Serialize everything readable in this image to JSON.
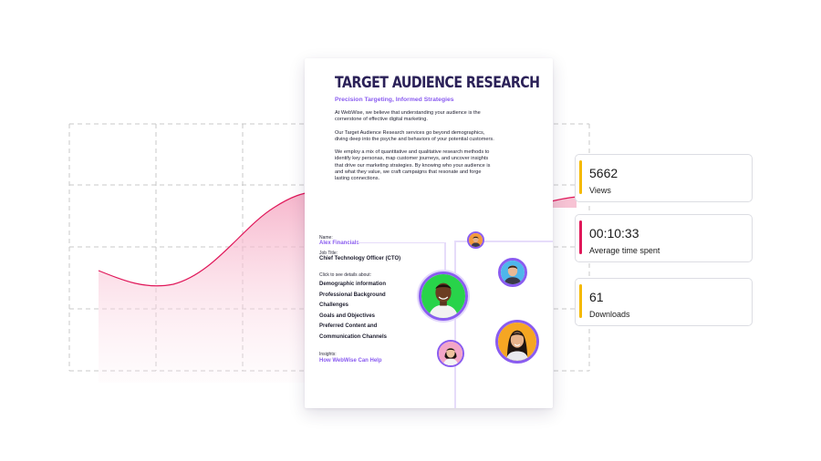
{
  "document": {
    "title": "TARGET AUDIENCE RESEARCH",
    "subtitle": "Precision Targeting, Informed Strategies",
    "paragraphs": [
      "At WebWise, we believe that understanding your audience is the cornerstone of effective digital marketing.",
      "Our Target Audience Research services go beyond demographics, diving deep into the psyche and behaviors of your potential customers.",
      "We employ a mix of quantitative and qualitative research methods to identify key personas, map customer journeys, and uncover insights that drive our marketing strategies. By knowing who your audience is and what they value, we craft campaigns that resonate and forge lasting connections."
    ],
    "name_label": "Name:",
    "name_value": "Alex Financials",
    "job_label": "Job Title:",
    "job_value": "Chief Technology Officer (CTO)",
    "details_label": "Click to see details about:",
    "details": [
      "Demographic information",
      "Professional Background",
      "Challenges",
      "Goals and Objectives",
      "Preferred Content and",
      "Communication Channels"
    ],
    "insights_label": "Insights:",
    "insights_value": "How WebWise Can Help"
  },
  "stats": [
    {
      "value": "5662",
      "label": "Views",
      "color": "#f5b900"
    },
    {
      "value": "00:10:33",
      "label": "Average time spent",
      "color": "#e0185a"
    },
    {
      "value": "61",
      "label": "Downloads",
      "color": "#f5b900"
    }
  ],
  "colors": {
    "accent_purple": "#8a5cf0",
    "title_navy": "#2b2158",
    "chart_line": "#e0185a",
    "chart_fill": "#f7c3d4"
  },
  "icons": [
    "avatar-man-green",
    "avatar-man-orange",
    "avatar-man-blue",
    "avatar-woman-orange",
    "avatar-woman-pink"
  ]
}
